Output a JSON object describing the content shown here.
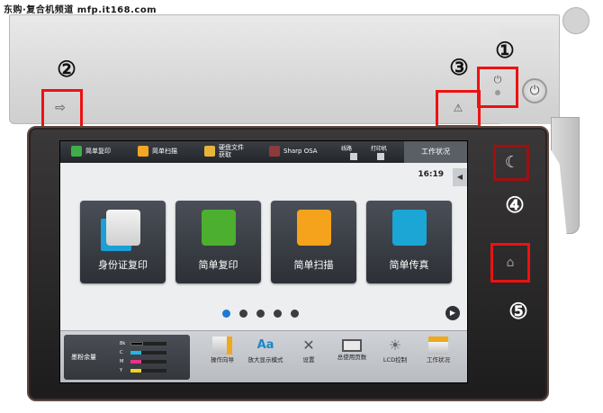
{
  "watermark": "东购·复合机频道 mfp.it168.com",
  "callouts": {
    "c1": "①",
    "c2": "②",
    "c3": "③",
    "c4": "④",
    "c5": "⑤"
  },
  "status_bar": {
    "items": [
      {
        "label": "简单复印",
        "icon": "copy-icon"
      },
      {
        "label": "简单扫描",
        "icon": "scan-icon"
      },
      {
        "label": "硬盘文件获取",
        "icon": "folder-icon"
      },
      {
        "label": "Sharp OSA",
        "icon": "osa-icon"
      }
    ],
    "line_label": "线路",
    "printer_label": "打印机",
    "job_status": "工作状况"
  },
  "clock": "16:19",
  "tiles": [
    {
      "label": "身份证复印",
      "icon": "id-copy-icon"
    },
    {
      "label": "简单复印",
      "icon": "easy-copy-icon"
    },
    {
      "label": "简单扫描",
      "icon": "easy-scan-icon"
    },
    {
      "label": "简单传真",
      "icon": "easy-fax-icon"
    }
  ],
  "pagination": {
    "pages": 5,
    "active": 1
  },
  "toner": {
    "title": "墨粉余量",
    "rows": [
      {
        "label": "Bk",
        "level": 0.35,
        "color": "#111111"
      },
      {
        "label": "C",
        "level": 0.3,
        "color": "#1fb8e8"
      },
      {
        "label": "M",
        "level": 0.3,
        "color": "#e8328b"
      },
      {
        "label": "Y",
        "level": 0.3,
        "color": "#f0d41e"
      }
    ]
  },
  "toolbar": [
    {
      "label": "操作向导",
      "icon": "guide-icon"
    },
    {
      "label": "放大显示模式",
      "icon": "magnify-icon"
    },
    {
      "label": "设置",
      "icon": "settings-icon"
    },
    {
      "label": "总使用页数",
      "icon": "counter-icon"
    },
    {
      "label": "LCD控制",
      "icon": "brightness-icon"
    },
    {
      "label": "工作状况",
      "icon": "job-status-icon"
    }
  ],
  "colors": {
    "callout": "#ee1111",
    "accent": "#1f78d1"
  }
}
